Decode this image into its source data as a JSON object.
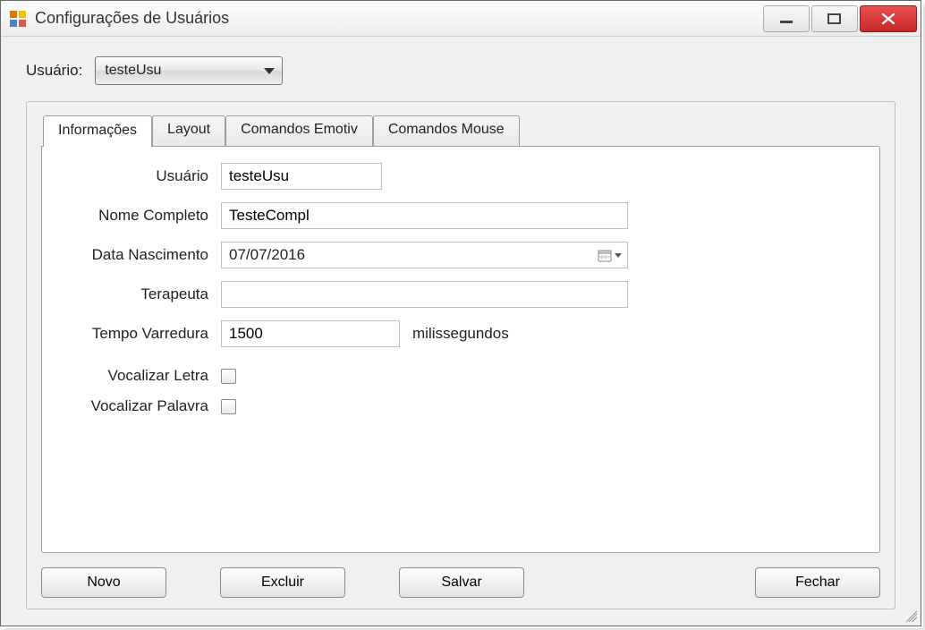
{
  "window": {
    "title": "Configurações de Usuários"
  },
  "topRow": {
    "label": "Usuário:",
    "selected": "testeUsu"
  },
  "tabs": {
    "informacoes": "Informações",
    "layout": "Layout",
    "comandosEmotiv": "Comandos Emotiv",
    "comandosMouse": "Comandos Mouse"
  },
  "form": {
    "usuarioLabel": "Usuário",
    "usuarioValue": "testeUsu",
    "nomeCompletoLabel": "Nome Completo",
    "nomeCompletoValue": "TesteCompl",
    "dataNascimentoLabel": "Data Nascimento",
    "dataNascimentoValue": "07/07/2016",
    "terapeutaLabel": "Terapeuta",
    "terapeutaValue": "",
    "tempoVarreduraLabel": "Tempo Varredura",
    "tempoVarreduraValue": "1500",
    "tempoVarreduraUnit": "milissegundos",
    "vocalizarLetraLabel": "Vocalizar Letra",
    "vocalizarLetraChecked": false,
    "vocalizarPalavraLabel": "Vocalizar Palavra",
    "vocalizarPalavraChecked": false
  },
  "buttons": {
    "novo": "Novo",
    "excluir": "Excluir",
    "salvar": "Salvar",
    "fechar": "Fechar"
  }
}
